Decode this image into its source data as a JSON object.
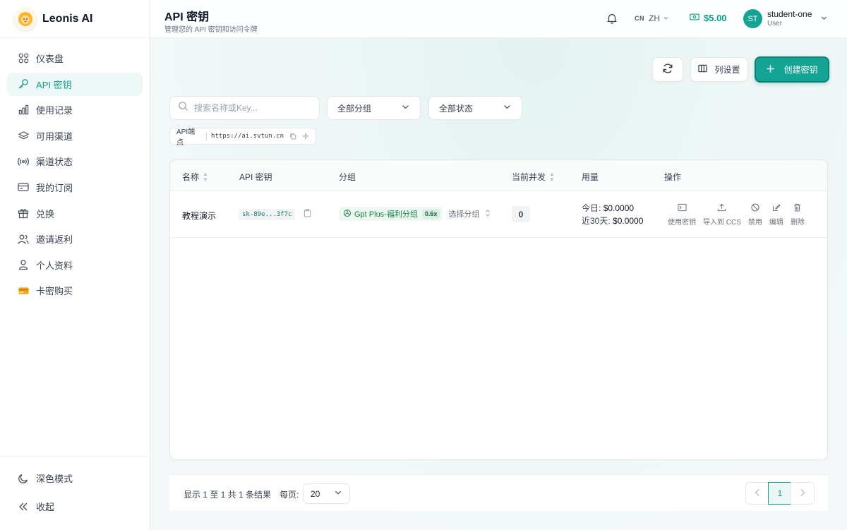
{
  "brand": {
    "name": "Leonis AI"
  },
  "sidebar": {
    "items": [
      {
        "label": "仪表盘",
        "icon": "dashboard-icon"
      },
      {
        "label": "API 密钥",
        "icon": "key-icon",
        "active": true
      },
      {
        "label": "使用记录",
        "icon": "bar-chart-icon"
      },
      {
        "label": "可用渠道",
        "icon": "layers-icon"
      },
      {
        "label": "渠道状态",
        "icon": "signal-icon"
      },
      {
        "label": "我的订阅",
        "icon": "card-icon"
      },
      {
        "label": "兑换",
        "icon": "gift-icon"
      },
      {
        "label": "邀请返利",
        "icon": "users-icon"
      },
      {
        "label": "个人资料",
        "icon": "user-icon"
      },
      {
        "label": "卡密购买",
        "icon": "ticket-icon"
      }
    ],
    "bottom": [
      {
        "label": "深色模式",
        "icon": "moon-icon"
      },
      {
        "label": "收起",
        "icon": "collapse-icon"
      }
    ]
  },
  "header": {
    "title": "API 密钥",
    "subtitle": "管理您的 API 密钥和访问令牌",
    "lang_code": "CN",
    "lang": "ZH",
    "balance": "$5.00",
    "user": {
      "initials": "ST",
      "name": "student-one",
      "role": "User"
    }
  },
  "toolbar": {
    "columns_label": "列设置",
    "create_label": "创建密钥"
  },
  "filters": {
    "search_placeholder": "搜索名称或Key...",
    "group_value": "全部分组",
    "status_value": "全部状态"
  },
  "endpoint": {
    "label": "API端点",
    "url": "https://ai.svtun.cn"
  },
  "table": {
    "headers": {
      "name": "名称",
      "key": "API 密钥",
      "group": "分组",
      "concurrency": "当前并发",
      "usage": "用量",
      "actions": "操作"
    },
    "rows": [
      {
        "name": "教程演示",
        "key": "sk-89e...3f7c",
        "group": "Gpt Plus-福利分组",
        "ratio": "0.6x",
        "select_group": "选择分组",
        "concurrency": "0",
        "today_label": "今日:",
        "today_value": "$0.0000",
        "month_label": "近30天:",
        "month_value": "$0.0000",
        "actions": {
          "use_key": "使用密钥",
          "import_ccs": "导入到 CCS",
          "disable": "禁用",
          "edit": "编辑",
          "delete": "删除"
        }
      }
    ]
  },
  "pagination": {
    "summary": "显示 1 至 1 共 1 条结果",
    "per_page_label": "每页:",
    "per_page_value": "20",
    "current_page": "1"
  }
}
